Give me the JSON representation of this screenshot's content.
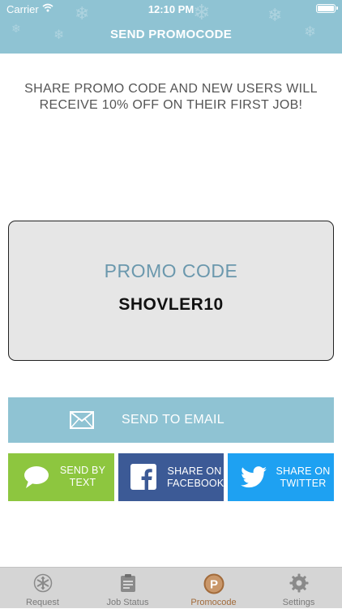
{
  "status_bar": {
    "carrier": "Carrier",
    "time": "12:10 PM"
  },
  "header": {
    "title": "SEND PROMOCODE",
    "background": "#8fc3d3"
  },
  "message": "SHARE PROMO CODE AND NEW USERS WILL RECEIVE 10% OFF ON THEIR FIRST JOB!",
  "promo": {
    "label": "PROMO CODE",
    "code": "SHOVLER10"
  },
  "actions": {
    "email": {
      "label": "SEND TO EMAIL",
      "icon": "envelope-icon",
      "color": "#8fc3d3"
    },
    "text": {
      "label_line1": "SEND BY",
      "label_line2": "TEXT",
      "icon": "chat-bubble-icon",
      "color": "#8dc63f"
    },
    "facebook": {
      "label_line1": "SHARE ON",
      "label_line2": "FACEBOOK",
      "icon": "facebook-icon",
      "color": "#3c5a96"
    },
    "twitter": {
      "label_line1": "SHARE ON",
      "label_line2": "TWITTER",
      "icon": "twitter-bird-icon",
      "color": "#1ea1f2"
    }
  },
  "tabbar": {
    "items": [
      {
        "label": "Request",
        "icon": "snowflake-icon",
        "active": false
      },
      {
        "label": "Job Status",
        "icon": "clipboard-icon",
        "active": false
      },
      {
        "label": "Promocode",
        "icon": "promo-p-icon",
        "active": true
      },
      {
        "label": "Settings",
        "icon": "gear-icon",
        "active": false
      }
    ],
    "active_color": "#a26b3b"
  }
}
